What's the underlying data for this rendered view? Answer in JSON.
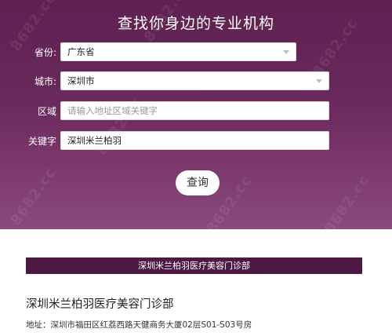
{
  "header": {
    "title": "查找你身边的专业机构"
  },
  "form": {
    "province": {
      "label": "省份:",
      "value": "广东省"
    },
    "city": {
      "label": "城市:",
      "value": "深圳市"
    },
    "area": {
      "label": "区域",
      "placeholder": "请输入地址区域关键字"
    },
    "keyword": {
      "label": "关键字",
      "value": "深圳米兰柏羽"
    },
    "search_label": "查询"
  },
  "results": {
    "bar_title": "深圳米兰柏羽医疗美容门诊部",
    "items": [
      {
        "name": "深圳米兰柏羽医疗美容门诊部",
        "address": "地址：深圳市福田区红荔西路天健商务大厦02层S01-S03号房"
      }
    ]
  },
  "watermark": {
    "text": "8682.cc"
  },
  "colors": {
    "hero_top": "#5e2150",
    "hero_bottom": "#8a4a7d",
    "result_bar": "#4e1a45"
  }
}
